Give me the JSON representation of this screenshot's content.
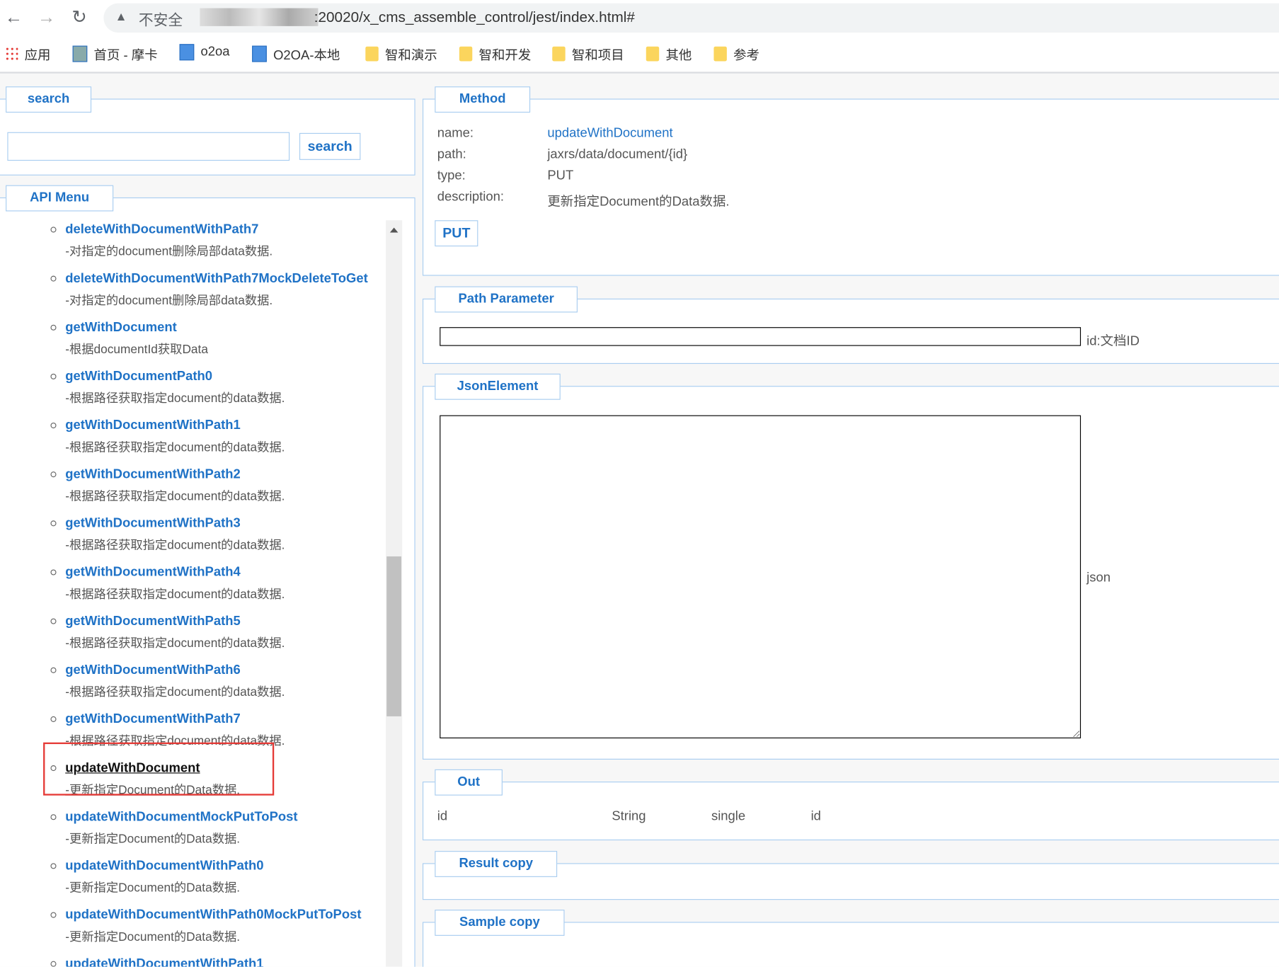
{
  "browser": {
    "back": "←",
    "forward": "→",
    "reload": "↻",
    "warning_icon": "▲",
    "insecure": "不安全",
    "url": ":20020/x_cms_assemble_control/jest/index.html#"
  },
  "bookmarks": [
    "应用",
    "首页 - 摩卡",
    "o2oa",
    "O2OA-本地",
    "智和演示",
    "智和开发",
    "智和项目",
    "其他",
    "参考"
  ],
  "search": {
    "legend": "search",
    "placeholder": "",
    "button": "search"
  },
  "menu": {
    "legend": "API Menu",
    "selected_index": 11,
    "items": [
      {
        "title": "deleteWithDocumentWithPath7",
        "desc": "-对指定的document删除局部data数据."
      },
      {
        "title": "deleteWithDocumentWithPath7MockDeleteToGet",
        "desc": "-对指定的document删除局部data数据."
      },
      {
        "title": "getWithDocument",
        "desc": "-根据documentId获取Data"
      },
      {
        "title": "getWithDocumentPath0",
        "desc": "-根据路径获取指定document的data数据."
      },
      {
        "title": "getWithDocumentWithPath1",
        "desc": "-根据路径获取指定document的data数据."
      },
      {
        "title": "getWithDocumentWithPath2",
        "desc": "-根据路径获取指定document的data数据."
      },
      {
        "title": "getWithDocumentWithPath3",
        "desc": "-根据路径获取指定document的data数据."
      },
      {
        "title": "getWithDocumentWithPath4",
        "desc": "-根据路径获取指定document的data数据."
      },
      {
        "title": "getWithDocumentWithPath5",
        "desc": "-根据路径获取指定document的data数据."
      },
      {
        "title": "getWithDocumentWithPath6",
        "desc": "-根据路径获取指定document的data数据."
      },
      {
        "title": "getWithDocumentWithPath7",
        "desc": "-根据路径获取指定document的data数据."
      },
      {
        "title": "updateWithDocument",
        "desc": "-更新指定Document的Data数据."
      },
      {
        "title": "updateWithDocumentMockPutToPost",
        "desc": "-更新指定Document的Data数据."
      },
      {
        "title": "updateWithDocumentWithPath0",
        "desc": "-更新指定Document的Data数据."
      },
      {
        "title": "updateWithDocumentWithPath0MockPutToPost",
        "desc": "-更新指定Document的Data数据."
      },
      {
        "title": "updateWithDocumentWithPath1",
        "desc": ""
      }
    ]
  },
  "method": {
    "legend": "Method",
    "name_label": "name:",
    "name": "updateWithDocument",
    "path_label": "path:",
    "path": "jaxrs/data/document/{id}",
    "type_label": "type:",
    "type": "PUT",
    "desc_label": "description:",
    "desc": "更新指定Document的Data数据.",
    "button": "PUT"
  },
  "path_param": {
    "legend": "Path Parameter",
    "value": "",
    "label": "id:文档ID"
  },
  "json_element": {
    "legend": "JsonElement",
    "value": "",
    "label": "json"
  },
  "out": {
    "legend": "Out",
    "row": [
      "id",
      "String",
      "single",
      "id"
    ]
  },
  "result": {
    "legend": "Result copy"
  },
  "sample": {
    "legend": "Sample copy"
  }
}
